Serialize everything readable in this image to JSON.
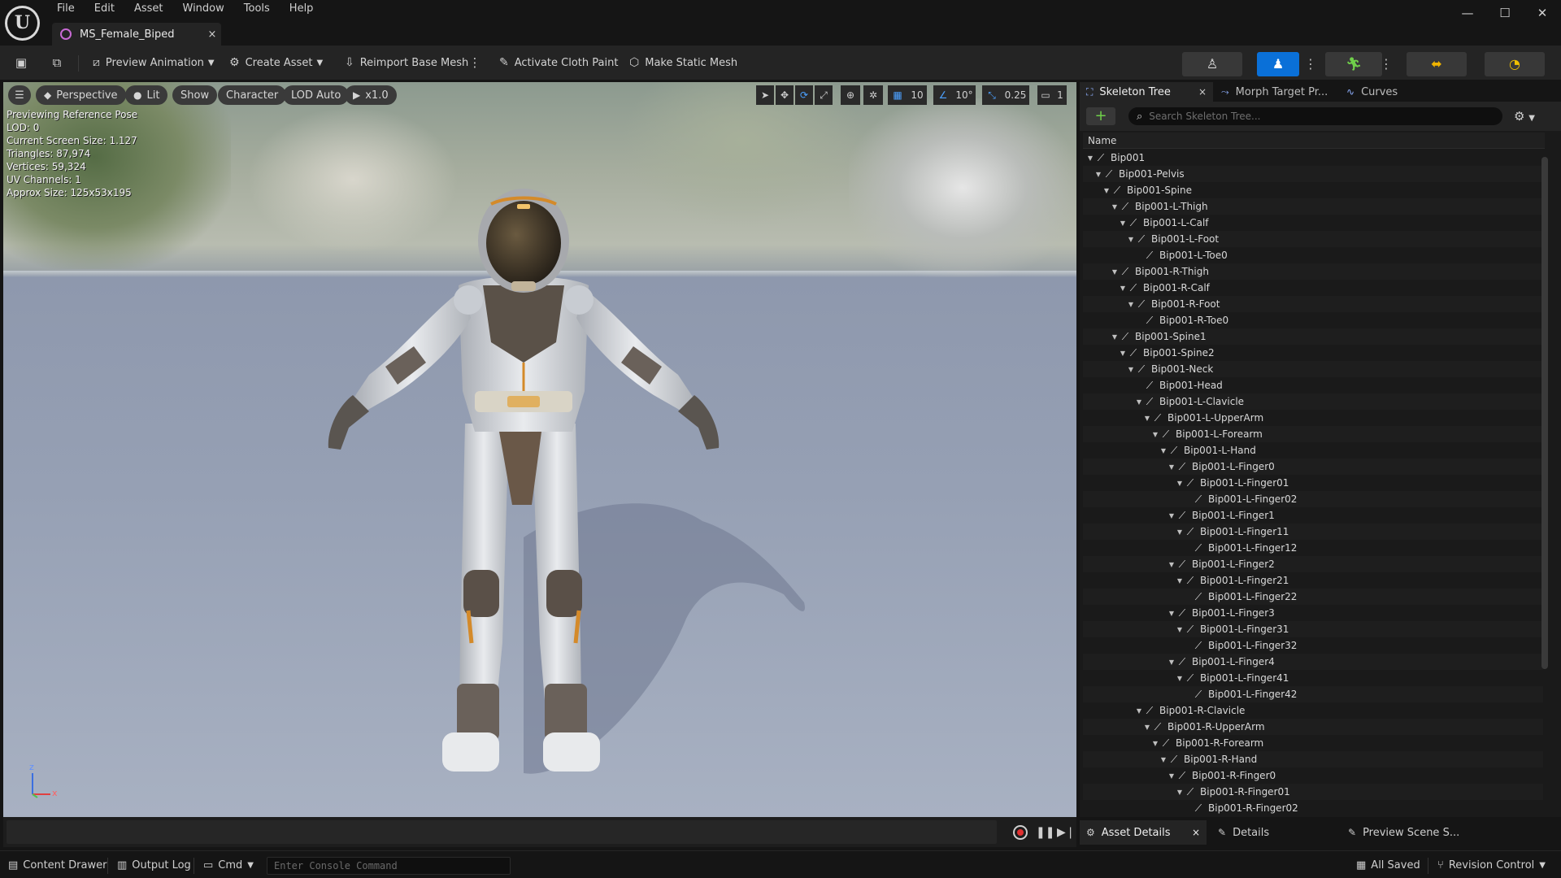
{
  "app": {
    "menu": [
      "File",
      "Edit",
      "Asset",
      "Window",
      "Tools",
      "Help"
    ],
    "document_tab": "MS_Female_Biped",
    "close_glyph": "×",
    "window_controls": [
      "—",
      "☐",
      "✕"
    ]
  },
  "toolbar": {
    "preview_animation": "Preview Animation",
    "create_asset": "Create Asset",
    "reimport_base_mesh": "Reimport Base Mesh",
    "activate_cloth_paint": "Activate Cloth Paint",
    "make_static_mesh": "Make Static Mesh"
  },
  "viewport": {
    "view_mode": "Perspective",
    "lighting": "Lit",
    "show": "Show",
    "character": "Character",
    "lod": "LOD Auto",
    "playback_speed": "x1.0",
    "grid_snap": "10",
    "rotation_snap": "10°",
    "scale_snap": "0.25",
    "camera_speed": "1",
    "stats": [
      "Previewing Reference Pose",
      "LOD: 0",
      "Current Screen Size: 1.127",
      "Triangles: 87,974",
      "Vertices: 59,324",
      "UV Channels: 1",
      "Approx Size: 125x53x195"
    ],
    "axis_labels": {
      "z": "z",
      "x": "x"
    }
  },
  "right_panel": {
    "tabs": [
      {
        "label": "Skeleton Tree",
        "active": true
      },
      {
        "label": "Morph Target Pr...",
        "active": false
      },
      {
        "label": "Curves",
        "active": false
      }
    ],
    "search_placeholder": "Search Skeleton Tree...",
    "column_header": "Name",
    "tree": [
      {
        "name": "Bip001",
        "depth": 0,
        "expanded": true
      },
      {
        "name": "Bip001-Pelvis",
        "depth": 1,
        "expanded": true
      },
      {
        "name": "Bip001-Spine",
        "depth": 2,
        "expanded": true
      },
      {
        "name": "Bip001-L-Thigh",
        "depth": 3,
        "expanded": true
      },
      {
        "name": "Bip001-L-Calf",
        "depth": 4,
        "expanded": true
      },
      {
        "name": "Bip001-L-Foot",
        "depth": 5,
        "expanded": true
      },
      {
        "name": "Bip001-L-Toe0",
        "depth": 6,
        "expanded": false
      },
      {
        "name": "Bip001-R-Thigh",
        "depth": 3,
        "expanded": true
      },
      {
        "name": "Bip001-R-Calf",
        "depth": 4,
        "expanded": true
      },
      {
        "name": "Bip001-R-Foot",
        "depth": 5,
        "expanded": true
      },
      {
        "name": "Bip001-R-Toe0",
        "depth": 6,
        "expanded": false
      },
      {
        "name": "Bip001-Spine1",
        "depth": 3,
        "expanded": true
      },
      {
        "name": "Bip001-Spine2",
        "depth": 4,
        "expanded": true
      },
      {
        "name": "Bip001-Neck",
        "depth": 5,
        "expanded": true
      },
      {
        "name": "Bip001-Head",
        "depth": 6,
        "expanded": false
      },
      {
        "name": "Bip001-L-Clavicle",
        "depth": 6,
        "expanded": true
      },
      {
        "name": "Bip001-L-UpperArm",
        "depth": 7,
        "expanded": true
      },
      {
        "name": "Bip001-L-Forearm",
        "depth": 8,
        "expanded": true
      },
      {
        "name": "Bip001-L-Hand",
        "depth": 9,
        "expanded": true
      },
      {
        "name": "Bip001-L-Finger0",
        "depth": 10,
        "expanded": true
      },
      {
        "name": "Bip001-L-Finger01",
        "depth": 11,
        "expanded": true
      },
      {
        "name": "Bip001-L-Finger02",
        "depth": 12,
        "expanded": false
      },
      {
        "name": "Bip001-L-Finger1",
        "depth": 10,
        "expanded": true
      },
      {
        "name": "Bip001-L-Finger11",
        "depth": 11,
        "expanded": true
      },
      {
        "name": "Bip001-L-Finger12",
        "depth": 12,
        "expanded": false
      },
      {
        "name": "Bip001-L-Finger2",
        "depth": 10,
        "expanded": true
      },
      {
        "name": "Bip001-L-Finger21",
        "depth": 11,
        "expanded": true
      },
      {
        "name": "Bip001-L-Finger22",
        "depth": 12,
        "expanded": false
      },
      {
        "name": "Bip001-L-Finger3",
        "depth": 10,
        "expanded": true
      },
      {
        "name": "Bip001-L-Finger31",
        "depth": 11,
        "expanded": true
      },
      {
        "name": "Bip001-L-Finger32",
        "depth": 12,
        "expanded": false
      },
      {
        "name": "Bip001-L-Finger4",
        "depth": 10,
        "expanded": true
      },
      {
        "name": "Bip001-L-Finger41",
        "depth": 11,
        "expanded": true
      },
      {
        "name": "Bip001-L-Finger42",
        "depth": 12,
        "expanded": false
      },
      {
        "name": "Bip001-R-Clavicle",
        "depth": 6,
        "expanded": true
      },
      {
        "name": "Bip001-R-UpperArm",
        "depth": 7,
        "expanded": true
      },
      {
        "name": "Bip001-R-Forearm",
        "depth": 8,
        "expanded": true
      },
      {
        "name": "Bip001-R-Hand",
        "depth": 9,
        "expanded": true
      },
      {
        "name": "Bip001-R-Finger0",
        "depth": 10,
        "expanded": true
      },
      {
        "name": "Bip001-R-Finger01",
        "depth": 11,
        "expanded": true
      },
      {
        "name": "Bip001-R-Finger02",
        "depth": 12,
        "expanded": false
      }
    ]
  },
  "bottom_right_tabs": {
    "asset_details": "Asset Details",
    "details": "Details",
    "preview_scene": "Preview Scene S..."
  },
  "statusbar": {
    "content_drawer": "Content Drawer",
    "output_log": "Output Log",
    "cmd": "Cmd",
    "console_placeholder": "Enter Console Command",
    "all_saved": "All Saved",
    "revision_control": "Revision Control"
  },
  "colors": {
    "accent": "#0a70d8",
    "panel_bg": "#242424",
    "window_bg": "#151515",
    "add_green": "#6fcf4a",
    "record_red": "#e03030"
  }
}
